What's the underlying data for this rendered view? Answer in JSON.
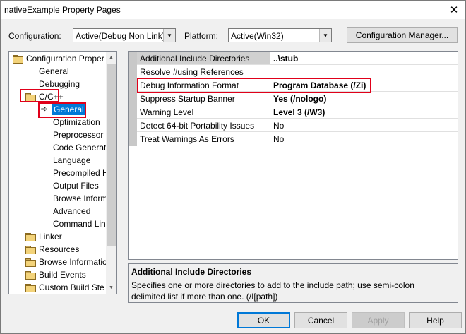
{
  "window": {
    "title": "nativeExample Property Pages"
  },
  "toolbar": {
    "configuration_label": "Configuration:",
    "configuration_value": "Active(Debug Non Link)",
    "platform_label": "Platform:",
    "platform_value": "Active(Win32)",
    "config_manager_label": "Configuration Manager..."
  },
  "tree": {
    "items": [
      {
        "label": "Configuration Proper",
        "icon": "folder-open-icon"
      },
      {
        "label": "General"
      },
      {
        "label": "Debugging"
      },
      {
        "label": "C/C++",
        "icon": "folder-open-icon",
        "highlighted": true
      },
      {
        "label": "General",
        "selected": true,
        "highlighted": true,
        "icon": "arrow-icon"
      },
      {
        "label": "Optimization"
      },
      {
        "label": "Preprocessor"
      },
      {
        "label": "Code Generati"
      },
      {
        "label": "Language"
      },
      {
        "label": "Precompiled H"
      },
      {
        "label": "Output Files"
      },
      {
        "label": "Browse Inform"
      },
      {
        "label": "Advanced"
      },
      {
        "label": "Command Lin"
      },
      {
        "label": "Linker",
        "icon": "folder-closed-icon"
      },
      {
        "label": "Resources",
        "icon": "folder-closed-icon"
      },
      {
        "label": "Browse Informatio",
        "icon": "folder-closed-icon"
      },
      {
        "label": "Build Events",
        "icon": "folder-closed-icon"
      },
      {
        "label": "Custom Build Ste",
        "icon": "folder-closed-icon"
      }
    ]
  },
  "grid": {
    "rows": [
      {
        "name": "Additional Include Directories",
        "value": "..\\stub",
        "bold": true,
        "selected": true
      },
      {
        "name": "Resolve #using References",
        "value": "",
        "bold": false
      },
      {
        "name": "Debug Information Format",
        "value": "Program Database (/Zi)",
        "bold": true,
        "highlighted": true
      },
      {
        "name": "Suppress Startup Banner",
        "value": "Yes (/nologo)",
        "bold": true
      },
      {
        "name": "Warning Level",
        "value": "Level 3 (/W3)",
        "bold": true
      },
      {
        "name": "Detect 64-bit Portability Issues",
        "value": "No",
        "bold": false
      },
      {
        "name": "Treat Warnings As Errors",
        "value": "No",
        "bold": false
      }
    ]
  },
  "description": {
    "title": "Additional Include Directories",
    "text": "Specifies one or more directories to add to the include path; use semi-colon delimited list if more than one.     (/I[path])"
  },
  "buttons": {
    "ok": "OK",
    "cancel": "Cancel",
    "apply": "Apply",
    "help": "Help"
  },
  "colors": {
    "highlight_box": "#e0001a",
    "selection": "#0078d7"
  }
}
